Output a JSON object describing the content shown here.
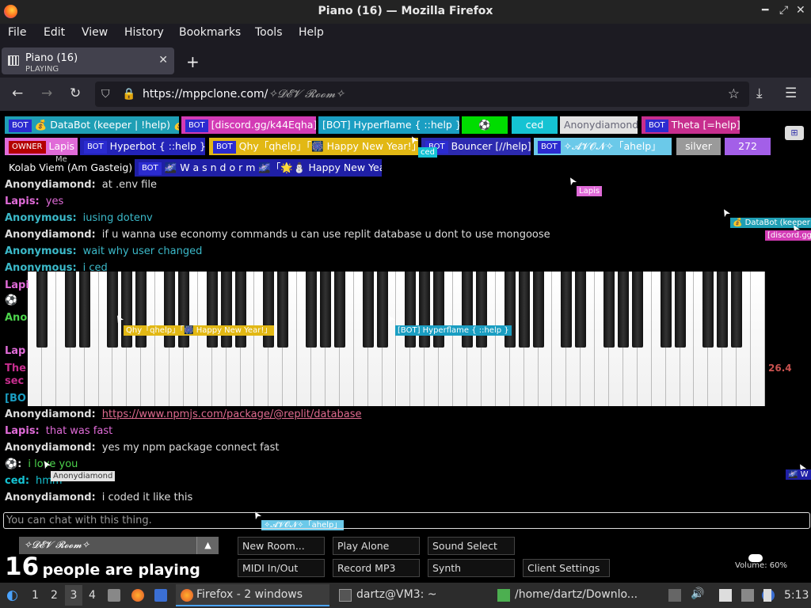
{
  "window": {
    "title": "Piano (16) — Mozilla Firefox"
  },
  "menu": [
    "File",
    "Edit",
    "View",
    "History",
    "Bookmarks",
    "Tools",
    "Help"
  ],
  "tab": {
    "title": "Piano (16)",
    "subtitle": "PLAYING"
  },
  "nav": {
    "url_host": "https://mppclone.com/",
    "url_path": "✧𝓓𝓔𝓥 𝓡𝓸𝓸𝓶✧"
  },
  "users": {
    "row1": [
      {
        "bot": "BOT",
        "name": "💰 DataBot (keeper | !help) 💰",
        "bg": "#1f9fb5"
      },
      {
        "bot": "BOT",
        "name": "[discord.gg/k44Eqha]",
        "bg": "#d33bb5"
      },
      {
        "bot": "",
        "name": "[BOT] Hyperflame { ::help }",
        "bg": "#1a9ec2"
      },
      {
        "bot": "",
        "name": "⚽",
        "bg": "#00dd00"
      },
      {
        "bot": "",
        "name": "ced",
        "bg": "#15c3d3"
      },
      {
        "bot": "",
        "name": "Anonydiamond",
        "bg": "#e3e3e3",
        "fg": "#667"
      },
      {
        "bot": "BOT",
        "name": "Theta [=help]",
        "bg": "#c72e8e"
      }
    ],
    "row2": [
      {
        "own": "OWNER",
        "name": "Lapis",
        "bg": "#e06bd8"
      },
      {
        "bot": "BOT",
        "name": "Hyperbot { ::help }",
        "bg": "#2323b8"
      },
      {
        "bot": "BOT",
        "name": "Qhy「qhelp」「🎆 Happy New Year!」",
        "bg": "#e2b814"
      },
      {
        "bot": "BOT",
        "name": "Bouncer [//help]",
        "bg": "#2c2ab0"
      },
      {
        "bot": "BOT",
        "name": "✧𝓐𝓥𝓞𝓝✧「ahelp」",
        "bg": "#6bc9e9"
      },
      {
        "bot": "",
        "name": "silver",
        "bg": "#9a9a9a"
      },
      {
        "bot": "",
        "name": "272",
        "bg": "#a35fe8"
      }
    ],
    "row3": [
      {
        "bot": "",
        "name": "Kolab Viem (Am Gasteig)",
        "bg": "#000"
      },
      {
        "bot": "BOT",
        "name": "🌌 W a s n d o r m 🌌「🌟⛄ Happy New Year! 」",
        "bg": "#1f1fa6"
      }
    ]
  },
  "me_label": "Me",
  "chat": [
    {
      "name": "Anonydiamond:",
      "text": "at .env file",
      "nc": "#dddddd",
      "tc": "#dddddd"
    },
    {
      "name": "Lapis:",
      "text": "yes",
      "nc": "#e06bd8",
      "tc": "#e06bd8"
    },
    {
      "name": "Anonymous:",
      "text": "iusing dotenv",
      "nc": "#3bb9c9",
      "tc": "#3bb9c9"
    },
    {
      "name": "Anonydiamond:",
      "text": "if u wanna use economy commands u can use replit database u dont to use mongoose",
      "nc": "#dddddd",
      "tc": "#dddddd"
    },
    {
      "name": "Anonymous:",
      "text": "wait why user changed",
      "nc": "#3bb9c9",
      "tc": "#3bb9c9"
    },
    {
      "name": "Anonymous:",
      "text": "i ced",
      "nc": "#3bb9c9",
      "tc": "#3bb9c9"
    }
  ],
  "chat_lower": [
    {
      "name": "Anonydiamond:",
      "text": "https://www.npmjs.com/package/@replit/database",
      "nc": "#dddddd",
      "tc": "#e06b90",
      "link": true
    },
    {
      "name": "Lapis:",
      "text": "that was fast",
      "nc": "#e06bd8",
      "tc": "#e06bd8"
    },
    {
      "name": "Anonydiamond:",
      "text": "yes my npm package connect fast",
      "nc": "#dddddd",
      "tc": "#dddddd"
    },
    {
      "name": "⚽:",
      "text": "i love you",
      "nc": "#dddddd",
      "tc": "#4cd44c"
    },
    {
      "name": "ced:",
      "text": "hmm",
      "nc": "#15c3d3",
      "tc": "#15c3d3"
    },
    {
      "name": "Anonydiamond:",
      "text": "i coded it like this",
      "nc": "#dddddd",
      "tc": "#dddddd"
    }
  ],
  "partial_names": [
    "Lapi",
    "⚽",
    "Ano",
    "Lap",
    "The",
    "sec",
    "[BO"
  ],
  "cursors": [
    {
      "label": "Lapis",
      "bg": "#e06bd8"
    },
    {
      "label": "💰 DataBot (keeper",
      "bg": "#1f9fb5"
    },
    {
      "label": "[discord.gg",
      "bg": "#d33bb5"
    },
    {
      "label": "Qhy「qhelp」「🎆 Happy New Year!」",
      "bg": "#e2b814"
    },
    {
      "label": "[BOT] Hyperflame { ::help }",
      "bg": "#1a9ec2"
    },
    {
      "label": "Anonydiamond",
      "bg": "#e3e3e3"
    },
    {
      "label": "✧𝓐𝓥𝓞𝓝✧「ahelp」",
      "bg": "#6bc9e9"
    },
    {
      "label": "🌌 W a",
      "bg": "#1f1fa6"
    },
    {
      "label": "ced",
      "bg": "#15c3d3"
    }
  ],
  "piano_side_value": "26.4",
  "chat_placeholder": "You can chat with this thing.",
  "room_select": "✧𝓓𝓔𝓥 𝓡𝓸𝓸𝓶✧",
  "people_count": "16",
  "people_text": "people are playing",
  "buttons": [
    "New Room...",
    "Play Alone",
    "Sound Select",
    "MIDI In/Out",
    "Record MP3",
    "Synth",
    "Client Settings"
  ],
  "volume": "Volume: 60%",
  "taskbar": {
    "workspaces": [
      "1",
      "2",
      "3",
      "4"
    ],
    "active_ws": "3",
    "tasks": [
      "Firefox - 2 windows",
      "dartz@VM3: ~",
      "/home/dartz/Downlo..."
    ],
    "clock": "5:13"
  }
}
